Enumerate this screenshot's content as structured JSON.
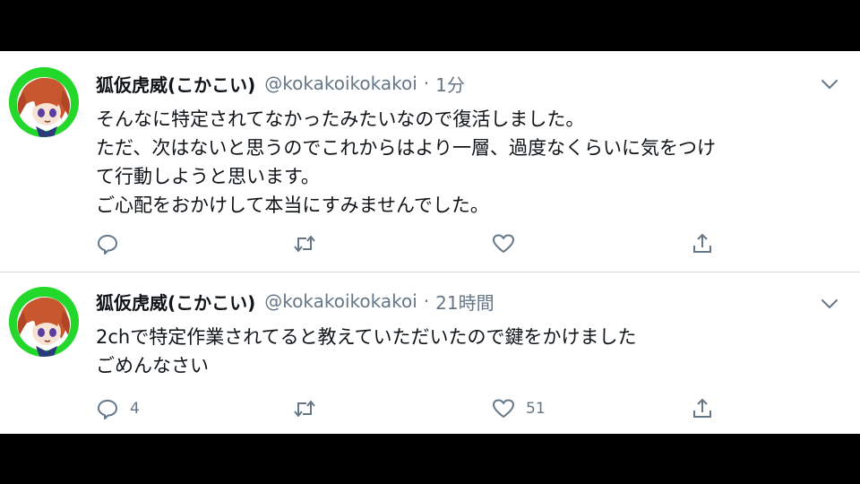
{
  "tweets": [
    {
      "display_name": "狐仮虎威(こかこい)",
      "handle": "@kokakoikokakoi",
      "separator": "·",
      "time": "1分",
      "lines": [
        "そんなに特定されてなかったみたいなので復活しました。",
        "ただ、次はないと思うのでこれからはより一層、過度なくらいに気をつけ",
        "て行動しようと思います。",
        "ご心配をおかけして本当にすみませんでした。"
      ],
      "reply_count": "",
      "retweet_count": "",
      "like_count": ""
    },
    {
      "display_name": "狐仮虎威(こかこい)",
      "handle": "@kokakoikokakoi",
      "separator": "·",
      "time": "21時間",
      "lines": [
        "2chで特定作業されてると教えていただいたので鍵をかけました",
        "ごめんなさい"
      ],
      "reply_count": "4",
      "retweet_count": "",
      "like_count": "51"
    }
  ],
  "icons": {
    "reply": "reply-icon",
    "retweet": "retweet-icon",
    "like": "like-icon",
    "share": "share-icon",
    "more": "chevron-down-icon"
  },
  "colors": {
    "avatar_ring": "#23d82b",
    "muted_text": "#657786",
    "body_text": "#0f1419",
    "letterbox": "#000000"
  }
}
